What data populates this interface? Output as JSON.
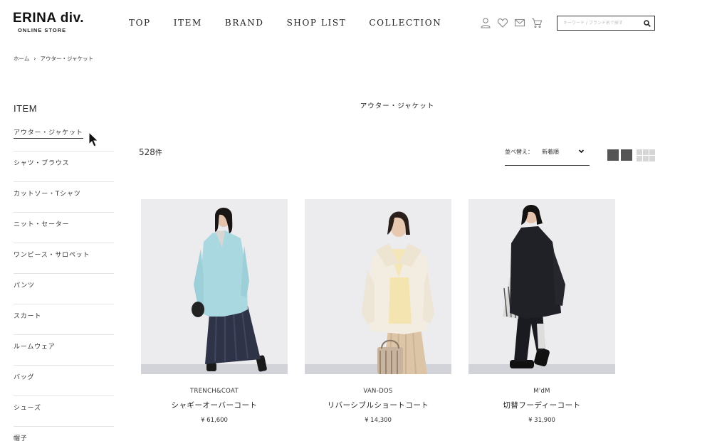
{
  "header": {
    "logo_main": "ERINA div.",
    "logo_sub": "ONLINE STORE",
    "nav": [
      "TOP",
      "ITEM",
      "BRAND",
      "SHOP LIST",
      "COLLECTION"
    ],
    "icons": [
      "user-icon",
      "heart-icon",
      "mail-icon",
      "cart-icon"
    ],
    "search_placeholder": "キーワード / ブランド名で探す"
  },
  "breadcrumb": {
    "home": "ホーム",
    "separator": "›",
    "current": "アウター・ジャケット"
  },
  "sidebar": {
    "title": "ITEM",
    "items": [
      "アウター・ジャケット",
      "シャツ・ブラウス",
      "カットソー・Tシャツ",
      "ニット・セーター",
      "ワンピース・サロペット",
      "パンツ",
      "スカート",
      "ルームウェア",
      "バッグ",
      "シューズ",
      "帽子"
    ]
  },
  "main": {
    "category_title": "アウター・ジャケット",
    "count_number": "528",
    "count_unit": "件",
    "sort_label": "並べ替え：",
    "sort_value": "新着順",
    "products": [
      {
        "brand": "TRENCH&COAT",
        "name": "シャギーオーバーコート",
        "price": "¥ 61,600"
      },
      {
        "brand": "VAN-DOS",
        "name": "リバーシブルショートコート",
        "price": "¥ 14,300"
      },
      {
        "brand": "M'dM",
        "name": "切替フーディーコート",
        "price": "¥ 31,900"
      }
    ]
  },
  "colors": {
    "text": "#222222",
    "divider": "#e3e3e3",
    "photo_bg": "#ecebed",
    "coat_blue": "#a9d8e0",
    "coat_cream": "#f3ece0",
    "coat_black": "#1f2126"
  }
}
